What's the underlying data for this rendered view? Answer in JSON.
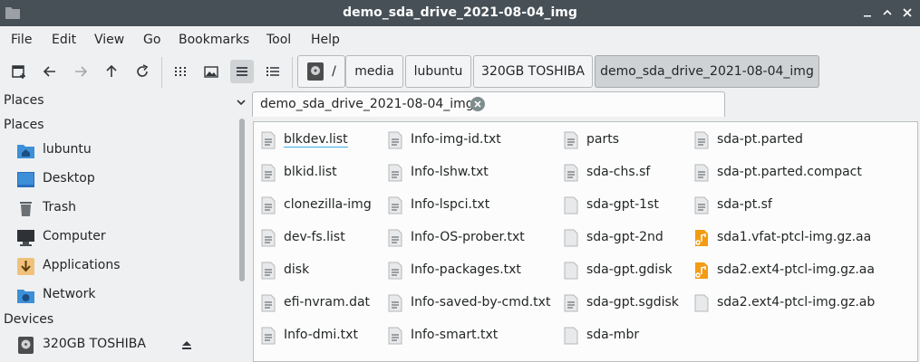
{
  "window": {
    "title": "demo_sda_drive_2021-08-04_img"
  },
  "menu": [
    "File",
    "Edit",
    "View",
    "Go",
    "Bookmarks",
    "Tool",
    "Help"
  ],
  "breadcrumb": [
    "/",
    "media",
    "lubuntu",
    "320GB TOSHIBA",
    "demo_sda_drive_2021-08-04_img"
  ],
  "sidebar": {
    "top_label": "Places",
    "places_header": "Places",
    "places": [
      {
        "label": "lubuntu",
        "icon": "home-folder-icon"
      },
      {
        "label": "Desktop",
        "icon": "desktop-icon"
      },
      {
        "label": "Trash",
        "icon": "trash-icon"
      },
      {
        "label": "Computer",
        "icon": "computer-icon"
      },
      {
        "label": "Applications",
        "icon": "applications-icon"
      },
      {
        "label": "Network",
        "icon": "network-icon"
      }
    ],
    "devices_header": "Devices",
    "devices": [
      {
        "label": "320GB TOSHIBA",
        "icon": "drive-icon"
      }
    ]
  },
  "tab": {
    "label": "demo_sda_drive_2021-08-04_img"
  },
  "files": {
    "col1": [
      "blkdev.list",
      "blkid.list",
      "clonezilla-img",
      "dev-fs.list",
      "disk",
      "efi-nvram.dat",
      "Info-dmi.txt"
    ],
    "col2": [
      "Info-img-id.txt",
      "Info-lshw.txt",
      "Info-lspci.txt",
      "Info-OS-prober.txt",
      "Info-packages.txt",
      "Info-saved-by-cmd.txt",
      "Info-smart.txt"
    ],
    "col3": [
      "parts",
      "sda-chs.sf",
      "sda-gpt-1st",
      "sda-gpt-2nd",
      "sda-gpt.gdisk",
      "sda-gpt.sgdisk",
      "sda-mbr"
    ],
    "col4": [
      "sda-pt.parted",
      "sda-pt.parted.compact",
      "sda-pt.sf",
      "sda1.vfat-ptcl-img.gz.aa",
      "sda2.ext4-ptcl-img.gz.aa",
      "sda2.ext4-ptcl-img.gz.ab"
    ]
  },
  "colors": {
    "titlebar": "#475057",
    "accent": "#3daee9",
    "archive": "#f39c12"
  }
}
